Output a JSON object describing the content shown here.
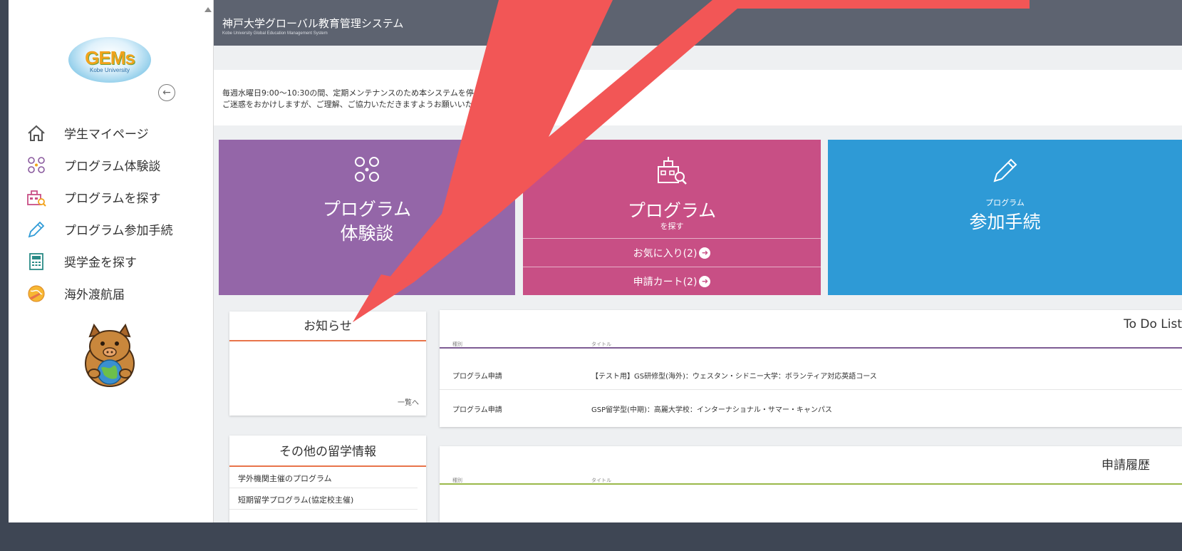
{
  "logo": {
    "text": "GEMs",
    "sub": "Kobe University"
  },
  "sidebar": {
    "items": [
      {
        "label": "学生マイページ",
        "icon": "home-icon"
      },
      {
        "label": "プログラム体験談",
        "icon": "people-icon"
      },
      {
        "label": "プログラムを探す",
        "icon": "school-search-icon"
      },
      {
        "label": "プログラム参加手続",
        "icon": "pencil-icon"
      },
      {
        "label": "奨学金を探す",
        "icon": "calculator-icon"
      },
      {
        "label": "海外渡航届",
        "icon": "globe-plane-icon"
      }
    ]
  },
  "header": {
    "title": "神戸大学グローバル教育管理システム",
    "subtitle": "Kobe University Global Education Management System"
  },
  "notice": {
    "line1": "毎週水曜日9:00～10:30の間、定期メンテナンスのため本システムを停",
    "line2": "ご迷惑をおかけしますが、ご理解、ご協力いただきますようお願いいた"
  },
  "tiles": {
    "experience": {
      "line1": "プログラム",
      "line2": "体験談"
    },
    "search": {
      "line1": "プログラム",
      "line2": "を探す",
      "favorites": "お気に入り(2)",
      "cart": "申請カート(2)"
    },
    "procedure": {
      "line1": "プログラム",
      "line2": "参加手続"
    }
  },
  "news": {
    "title": "お知らせ",
    "more": "一覧へ"
  },
  "other_info": {
    "title": "その他の留学情報",
    "items": [
      "学外機関主催のプログラム",
      "短期留学プログラム(協定校主催)"
    ]
  },
  "todo": {
    "title": "To Do List",
    "col_type": "種別",
    "col_title": "タイトル",
    "rows": [
      {
        "type": "プログラム申請",
        "title": "【テスト用】GS研修型(海外)：ウェスタン・シドニー大学：ボランティア対応英語コース"
      },
      {
        "type": "プログラム申請",
        "title": "GSP留学型(中期)：高麗大学校：インターナショナル・サマー・キャンパス"
      }
    ]
  },
  "history": {
    "title": "申請履歴",
    "col_type": "種別",
    "col_title": "タイトル"
  },
  "colors": {
    "purple_tile": "#9466a8",
    "pink_tile": "#c84f85",
    "blue_tile": "#2e9ad6",
    "header_bar": "#5d6370",
    "annotation_arrow": "#f25656"
  }
}
